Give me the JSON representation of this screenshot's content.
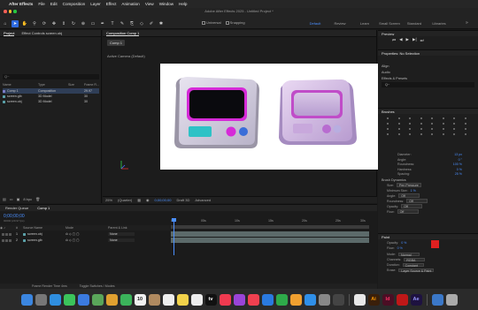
{
  "menubar": {
    "app_name": "After Effects",
    "items": [
      "File",
      "Edit",
      "Composition",
      "Layer",
      "Effect",
      "Animation",
      "View",
      "Window",
      "Help"
    ],
    "datetime": "Mon 10 Feb  01:32"
  },
  "window_title": "Adobe After Effects 2025 - Untitled Project *",
  "toolbar": {
    "options": [
      "Universal",
      "Snapping"
    ],
    "workspaces": [
      "Default",
      "Review",
      "Learn",
      "Small Screen",
      "Standard",
      "Libraries"
    ],
    "active_workspace": "Default"
  },
  "project": {
    "tabs": [
      "Project",
      "Effect Controls screen.obj"
    ],
    "search_placeholder": "Q~",
    "columns": [
      "Name",
      "Type",
      "Size",
      "Frame R..."
    ],
    "items": [
      {
        "name": "Comp 1",
        "type": "Composition",
        "size": "",
        "frame": "29.97",
        "color": "#7c7cc7"
      },
      {
        "name": "screen.glb",
        "type": "3D Model",
        "size": "",
        "frame": "30",
        "color": "#5aa0a8"
      },
      {
        "name": "screen.obj",
        "type": "3D Model",
        "size": "",
        "frame": "30",
        "color": "#5aa0a8"
      }
    ],
    "footer": "8 bpc"
  },
  "composition": {
    "tab": "Composition Comp 1",
    "sub_tab": "Comp 1",
    "camera": "Active Camera (Default)",
    "controls": [
      "25%",
      "(Quarter)",
      "0;00;00;00",
      "Draft 3D",
      "Advanced"
    ]
  },
  "right_panel": {
    "preview": "Preview",
    "properties": "Properties: No Selection",
    "align": "Align",
    "audio": "Audio",
    "effects": "Effects & Presets",
    "effects_search": "Q~",
    "brushes": "Brushes",
    "brush_props": [
      {
        "label": "Diameter:",
        "value": "13 px"
      },
      {
        "label": "Angle:",
        "value": "0 °"
      },
      {
        "label": "Roundness:",
        "value": "100 %"
      },
      {
        "label": "Hardness:",
        "value": "0 %"
      },
      {
        "label": "Spacing:",
        "value": "25 %"
      }
    ],
    "brush_dynamics": "Brush Dynamics",
    "dynamics_rows": [
      {
        "label": "Size:",
        "value": "Pen Pressure"
      },
      {
        "label": "Minimum Size:",
        "value": "1 %"
      },
      {
        "label": "Angle:",
        "value": "Off"
      },
      {
        "label": "Roundness:",
        "value": "Off"
      },
      {
        "label": "Opacity:",
        "value": "Off"
      },
      {
        "label": "Flow:",
        "value": "Off"
      }
    ],
    "paint": "Paint",
    "paint_rows": [
      {
        "label": "Opacity:",
        "value": "0 %"
      },
      {
        "label": "Flow:",
        "value": "0 %"
      },
      {
        "label": "Mode:",
        "value": "Normal"
      },
      {
        "label": "Channels:",
        "value": "RGBA"
      },
      {
        "label": "Duration:",
        "value": "Constant"
      },
      {
        "label": "Erase:",
        "value": "Layer Source & Paint"
      }
    ],
    "paint_color_fg": "#e02020",
    "paint_color_bg": "#ffffff"
  },
  "timeline": {
    "tabs": [
      "Render Queue",
      "Comp 1"
    ],
    "timecode": "0;00;00;00",
    "timecode_sub": "00000 (29.97 fps)",
    "columns": [
      "#",
      "Source Name",
      "Mode",
      "Parent & Link"
    ],
    "layers": [
      {
        "num": "1",
        "name": "screen.obj",
        "mode": "",
        "parent": "None"
      },
      {
        "num": "2",
        "name": "screen.glb",
        "mode": "",
        "parent": "None"
      }
    ],
    "ruler": [
      "0s",
      "05s",
      "10s",
      "15s",
      "20s",
      "25s",
      "30s"
    ],
    "footer": [
      "Frame Render Time 4ms",
      "Toggle Switches / Modes"
    ]
  },
  "dock": {
    "apps": [
      {
        "name": "Finder",
        "color": "#3b86e0"
      },
      {
        "name": "Launchpad",
        "color": "#777"
      },
      {
        "name": "Safari",
        "color": "#2f8fe0"
      },
      {
        "name": "Messages",
        "color": "#3bc45b"
      },
      {
        "name": "Mail",
        "color": "#3b7be0"
      },
      {
        "name": "Maps",
        "color": "#5aa65a"
      },
      {
        "name": "Photos",
        "color": "#e0a030"
      },
      {
        "name": "FaceTime",
        "color": "#3bb45b"
      },
      {
        "name": "Calendar",
        "color": "#f0f0f0",
        "label": "10"
      },
      {
        "name": "Contacts",
        "color": "#b08a60"
      },
      {
        "name": "Reminders",
        "color": "#eeeeee"
      },
      {
        "name": "Notes",
        "color": "#f2d24a"
      },
      {
        "name": "Freeform",
        "color": "#ededed"
      },
      {
        "name": "TV",
        "color": "#111",
        "label": "tv"
      },
      {
        "name": "Music",
        "color": "#f03a50"
      },
      {
        "name": "Podcasts",
        "color": "#9a44d8"
      },
      {
        "name": "News",
        "color": "#f04050"
      },
      {
        "name": "Keynote",
        "color": "#2a7ae0"
      },
      {
        "name": "Numbers",
        "color": "#2eaa4a"
      },
      {
        "name": "Pages",
        "color": "#f0a030"
      },
      {
        "name": "App Store",
        "color": "#2f8fe8"
      },
      {
        "name": "System Settings",
        "color": "#888"
      },
      {
        "name": "iPhone Mirroring",
        "color": "#444"
      },
      {
        "name": "Chrome",
        "color": "#e8e8e8"
      },
      {
        "name": "Illustrator",
        "color": "#3a1f0a",
        "label": "Ai"
      },
      {
        "name": "InDesign",
        "color": "#4a0e24",
        "label": "Id"
      },
      {
        "name": "Acrobat",
        "color": "#c01818"
      },
      {
        "name": "After Effects",
        "color": "#1e1240",
        "label": "Ae"
      },
      {
        "name": "Downloads",
        "color": "#3b78c8"
      },
      {
        "name": "Trash",
        "color": "#aaa"
      }
    ]
  }
}
